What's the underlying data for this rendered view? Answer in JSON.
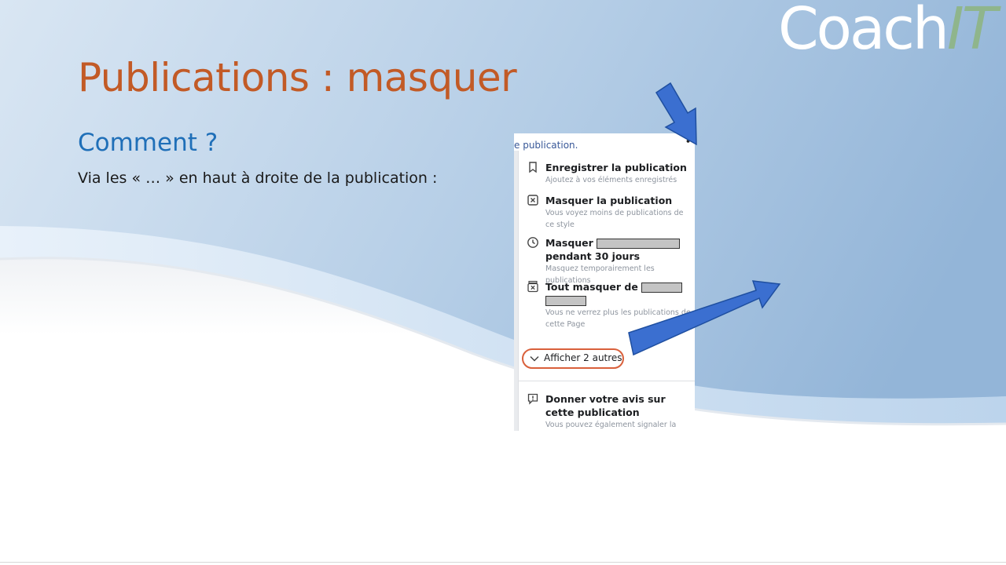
{
  "logo": {
    "part1": "Coach",
    "part2": "IT"
  },
  "slide": {
    "title": "Publications : masquer",
    "subtitle": "Comment ?",
    "text": "Via les « … » en haut à droite de la publication :"
  },
  "screenshot": {
    "post_snippet": "e publication.",
    "more_button": "•••",
    "menu": {
      "items": [
        {
          "icon": "bookmark-icon",
          "title": "Enregistrer la publication",
          "desc": "Ajoutez à vos éléments enregistrés"
        },
        {
          "icon": "hide-box-icon",
          "title": "Masquer la publication",
          "desc": "Vous voyez moins de publications de ce style"
        },
        {
          "icon": "clock-icon",
          "title_before": "Masquer",
          "title_after": "pendant 30 jours",
          "desc": "Masquez temporairement les publications"
        },
        {
          "icon": "hide-all-icon",
          "title_before": "Tout masquer de",
          "desc": "Vous ne verrez plus les publications de cette Page"
        }
      ],
      "show_more": {
        "icon": "chevron-down-icon",
        "label": "Afficher 2 autres"
      },
      "feedback": {
        "icon": "feedback-icon",
        "title": "Donner votre avis sur cette publication",
        "desc": "Vous pouvez également signaler la publication après avoir envoyé vos commentaires"
      }
    }
  },
  "colors": {
    "title": "#c25a26",
    "subtitle": "#1f6fb8",
    "arrow_fill": "#3b6fd0",
    "highlight": "#d9603b",
    "logo_accent": "#8fb58c"
  }
}
